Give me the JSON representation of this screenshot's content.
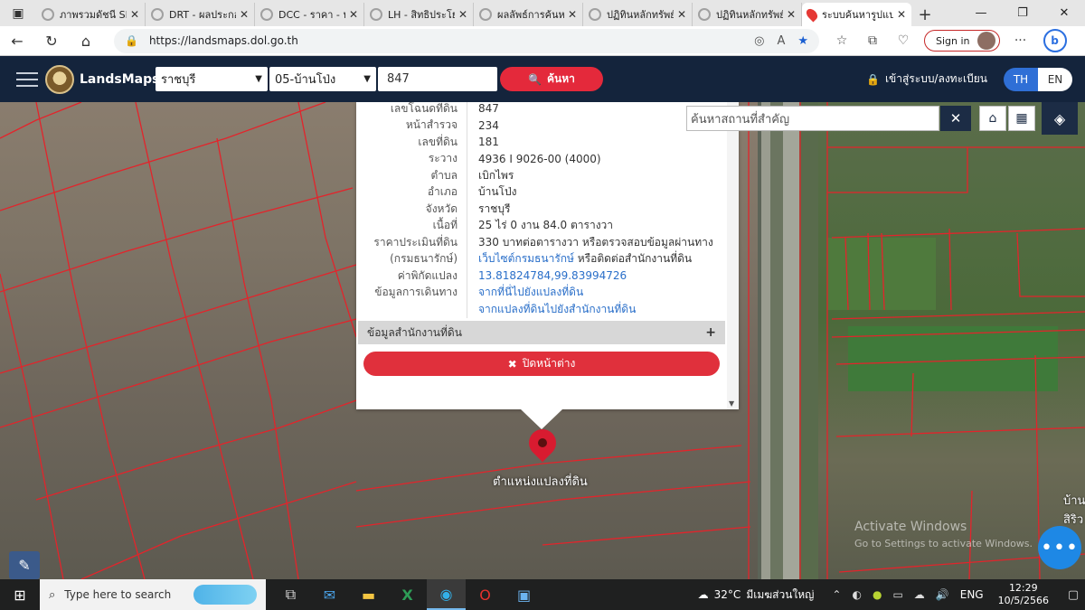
{
  "browser": {
    "tabs": [
      {
        "title": "ภาพรวมดัชนี SET",
        "active": false
      },
      {
        "title": "DRT - ผลประกอบการ",
        "active": false
      },
      {
        "title": "DCC - ราคา - หุ้น",
        "active": false
      },
      {
        "title": "LH - สิทธิประโยชน์",
        "active": false
      },
      {
        "title": "ผลลัพธ์การค้นหา",
        "active": false
      },
      {
        "title": "ปฏิทินหลักทรัพย์",
        "active": false
      },
      {
        "title": "ปฏิทินหลักทรัพย์",
        "active": false
      },
      {
        "title": "ระบบค้นหารูปแปลง",
        "active": true
      }
    ],
    "url": "https://landsmaps.dol.go.th",
    "signin_label": "Sign in",
    "copilot_letter": "b",
    "new_tab": "+",
    "window_controls": [
      "—",
      "❐",
      "✕"
    ]
  },
  "app": {
    "brand": "LandsMaps",
    "province": "ราชบุรี",
    "district": "05-บ้านโป่ง",
    "search_value": "847",
    "search_button": "ค้นหา",
    "login": "เข้าสู่ระบบ/ลงทะเบียน",
    "lang_th": "TH",
    "lang_en": "EN"
  },
  "map": {
    "place_search_placeholder": "ค้นหาสถานที่สำคัญ",
    "pin_label": "ตำแหน่งแปลงที่ดิน",
    "road_sign": "บ้าน สิริว",
    "watermark_title": "Activate Windows",
    "watermark_sub": "Go to Settings to activate Windows."
  },
  "panel": {
    "rows": [
      {
        "label": "เลขโฉนดที่ดิน",
        "value": "847"
      },
      {
        "label": "หน้าสำรวจ",
        "value": "234"
      },
      {
        "label": "เลขที่ดิน",
        "value": "181"
      },
      {
        "label": "ระวาง",
        "value": "4936 I 9026-00 (4000)"
      },
      {
        "label": "ตำบล",
        "value": "เบิกไพร"
      },
      {
        "label": "อำเภอ",
        "value": "บ้านโป่ง"
      },
      {
        "label": "จังหวัด",
        "value": "ราชบุรี"
      },
      {
        "label": "เนื้อที่",
        "value": "25 ไร่ 0 งาน 84.0 ตารางวา"
      },
      {
        "label": "ราคาประเมินที่ดิน",
        "value": "330 บาทต่อตารางวา หรือตรวจสอบข้อมูลผ่านทาง"
      },
      {
        "label": "(กรมธนารักษ์)",
        "value_link": "เว็บไซต์กรมธนารักษ์",
        "value_rest": " หรือติดต่อสำนักงานที่ดิน"
      },
      {
        "label": "ค่าพิกัดแปลง",
        "value": "13.81824784,99.83994726"
      },
      {
        "label": "ข้อมูลการเดินทาง",
        "value": "จากที่นี่ไปยังแปลงที่ดิน"
      },
      {
        "label": "",
        "value": "จากแปลงที่ดินไปยังสำนักงานที่ดิน"
      }
    ],
    "office_section": "ข้อมูลสำนักงานที่ดิน",
    "close_button": "ปิดหน้าต่าง"
  },
  "taskbar": {
    "search_placeholder": "Type here to search",
    "temperature": "32°C",
    "weather_text": "มีเมฆส่วนใหญ่",
    "language": "ENG",
    "time": "12:29",
    "date": "10/5/2566"
  }
}
